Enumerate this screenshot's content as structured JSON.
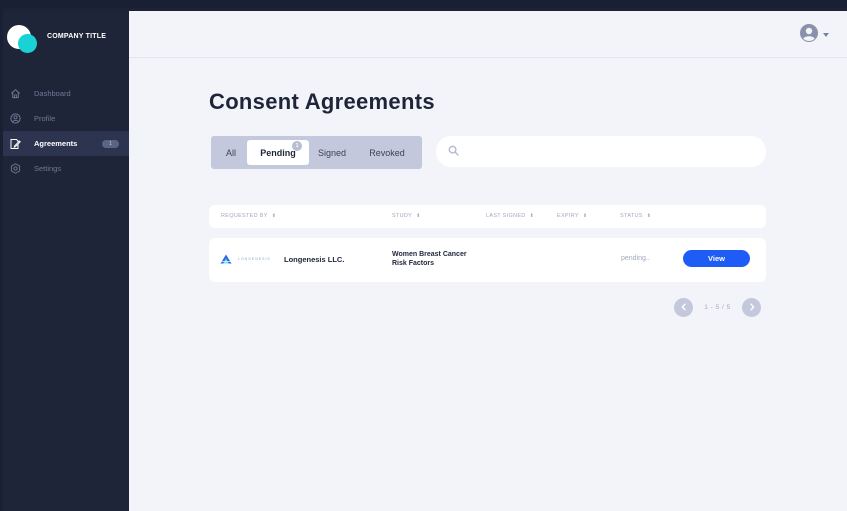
{
  "app": {
    "company_title": "COMPANY TITLE"
  },
  "sidebar": {
    "items": [
      {
        "label": "Dashboard",
        "icon": "home-icon"
      },
      {
        "label": "Profile",
        "icon": "user-circle-icon"
      },
      {
        "label": "Agreements",
        "icon": "document-sign-icon",
        "active": true,
        "badge": "1"
      },
      {
        "label": "Settings",
        "icon": "gear-icon"
      }
    ]
  },
  "header": {
    "avatar_icon": "user-avatar-icon"
  },
  "page": {
    "title": "Consent Agreements"
  },
  "tabs": {
    "all": "All",
    "pending": "Pending",
    "pending_count": "1",
    "signed": "Signed",
    "revoked": "Revoked",
    "active": "Pending"
  },
  "search": {
    "placeholder": "",
    "value": ""
  },
  "table": {
    "columns": {
      "requested_by": "REQUESTED BY",
      "study": "STUDY",
      "last_signed": "LAST SIGNED",
      "expiry": "EXPIRY",
      "status": "STATUS"
    },
    "sort_glyph": "⬍",
    "rows": [
      {
        "org_logo_text": "LONGENESIS",
        "org_name": "Longenesis LLC.",
        "study": "Women Breast Cancer Risk Factors",
        "last_signed": "",
        "expiry": "",
        "status": "pending..",
        "action": "View"
      }
    ]
  },
  "pagination": {
    "text": "1 - 5 / 5"
  },
  "colors": {
    "sidebar_bg": "#1f2539",
    "accent": "#19d2d6",
    "primary_button": "#1f5cf5",
    "main_bg": "#f3f4f9"
  }
}
